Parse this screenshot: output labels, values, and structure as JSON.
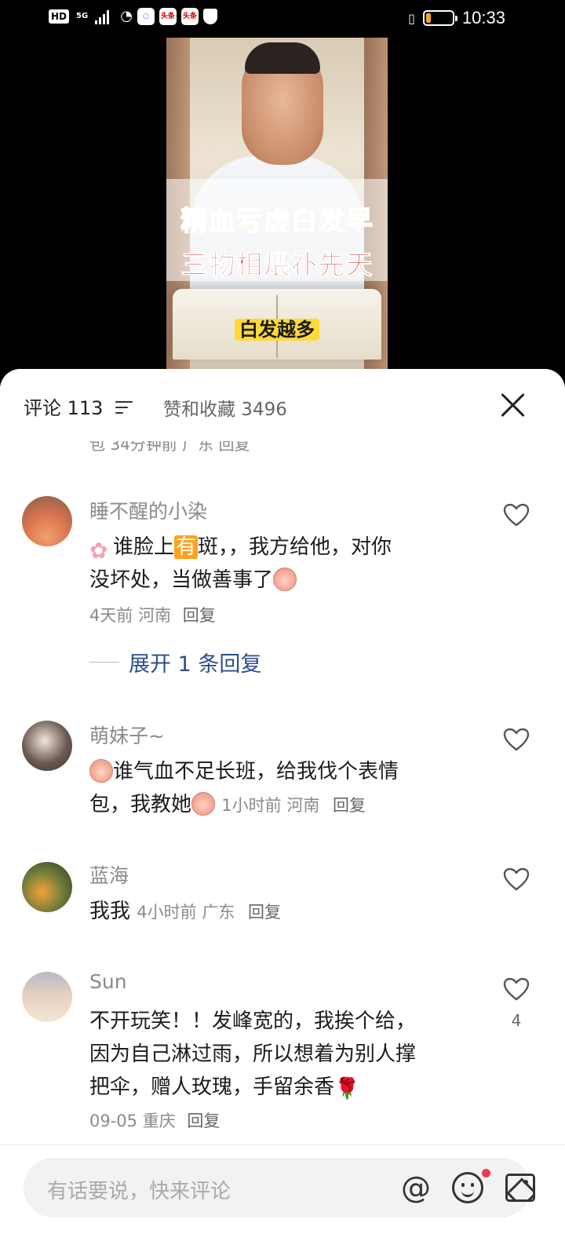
{
  "status_bar": {
    "hd": "HD",
    "net": "5G",
    "app1": "百度",
    "app2": "头条",
    "app3": "头条",
    "time": "10:33",
    "battery_level": 0.2,
    "battery_color": "#f5a623"
  },
  "video": {
    "headline_line1": "精血亏虚白发早",
    "headline_line2": "三物相煨补先天",
    "subtitle": "白发越多"
  },
  "sheet": {
    "comments_tab": "评论 113",
    "likes_tab": "赞和收藏 3496",
    "partial_row": "包 34分钟前 广东 回复"
  },
  "comments": [
    {
      "username": "睡不醒的小染",
      "text_before_highlight": "谁脸上",
      "highlight": "有",
      "text_line1_rest": "斑，，我方给他，对你",
      "text_line2": "没坏处，当做善事了",
      "time": "4天前",
      "location": "河南",
      "reply": "回复",
      "expand": "展开 1 条回复"
    },
    {
      "username": "萌妹子~",
      "text_line1": "谁气血不足长班，给我伐个表情",
      "text_line2": "包，我教她",
      "time": "1小时前",
      "location": "河南",
      "reply": "回复"
    },
    {
      "username": "蓝海",
      "text_line1": "我我",
      "time": "4小时前",
      "location": "广东",
      "reply": "回复"
    },
    {
      "username": "Sun",
      "text_line1": "不开玩笑！！发峰宽的，我挨个给，",
      "text_line2": "因为自己淋过雨，所以想着为别人撑",
      "text_line3": "把伞，赠人玫瑰，手留余香",
      "time": "09-05",
      "location": "重庆",
      "reply": "回复",
      "likes": "4"
    }
  ],
  "input": {
    "placeholder": "有话要说，快来评论",
    "at_symbol": "@"
  },
  "icons": {
    "sort": "sort-icon",
    "close": "close-icon",
    "heart": "heart-icon",
    "emoji": "emoji-icon",
    "image": "image-icon",
    "at": "at-icon"
  },
  "colors": {
    "highlight_bg": "#ffa21c",
    "expand_link": "#2d4e8c",
    "notification_dot": "#f03a47"
  }
}
